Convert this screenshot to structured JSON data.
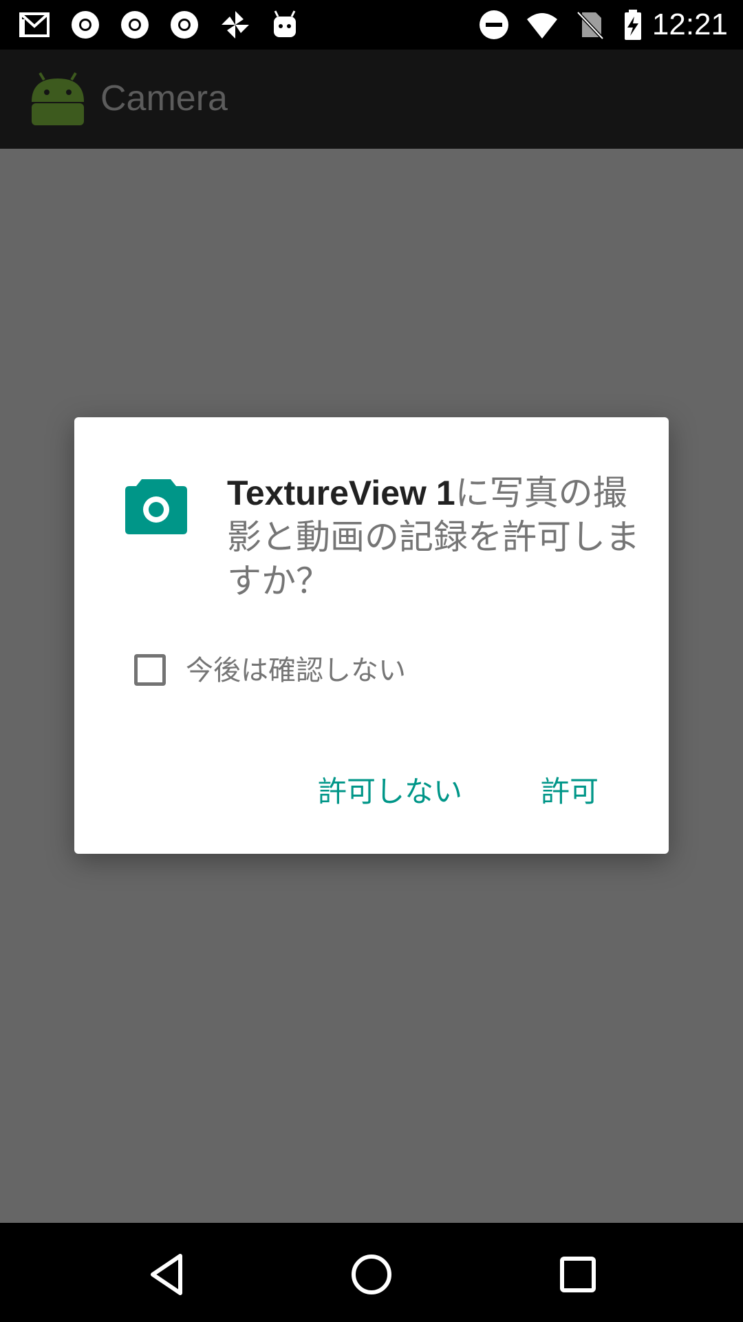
{
  "status_bar": {
    "time": "12:21",
    "left_icons": [
      "gmail-icon",
      "chrome-icon",
      "chrome-icon",
      "chrome-icon",
      "pinwheel-icon",
      "android-robot-icon"
    ],
    "right_icons": [
      "do-not-disturb-icon",
      "wifi-icon",
      "no-sim-icon",
      "battery-charging-icon"
    ]
  },
  "app_bar": {
    "title": "Camera",
    "icon": "android-icon"
  },
  "dialog": {
    "icon": "camera-icon",
    "app_name": "TextureView 1",
    "message_rest": "に写真の撮影と動画の記録を許可しますか？",
    "checkbox_label": "今後は確認しない",
    "checkbox_checked": false,
    "deny_label": "許可しない",
    "allow_label": "許可",
    "accent_color": "#009688"
  },
  "nav_bar": {
    "icons": [
      "back-icon",
      "home-icon",
      "recents-icon"
    ]
  }
}
